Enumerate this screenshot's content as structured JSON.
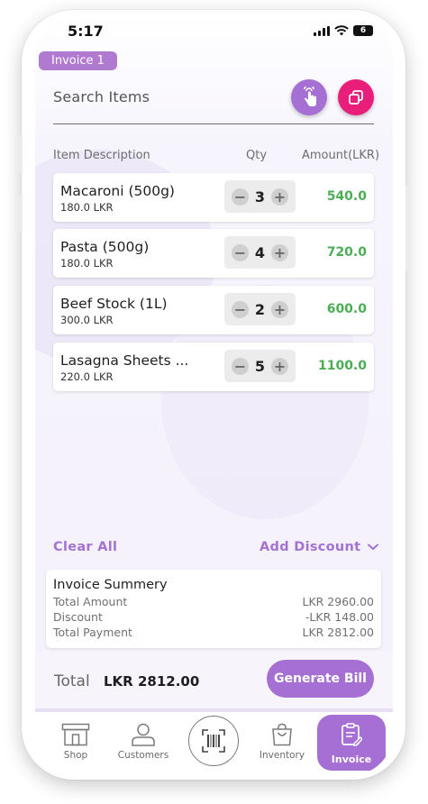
{
  "status_bar": {
    "time": "5:17",
    "battery": "6"
  },
  "invoice_tag": "Invoice 1",
  "search": {
    "placeholder": "Search Items"
  },
  "columns": {
    "description": "Item Description",
    "qty": "Qty",
    "amount": "Amount(LKR)"
  },
  "items": [
    {
      "name": "Macaroni (500g)",
      "unit_price": "180.0 LKR",
      "qty": "3",
      "amount": "540.0"
    },
    {
      "name": "Pasta (500g)",
      "unit_price": "180.0 LKR",
      "qty": "4",
      "amount": "720.0"
    },
    {
      "name": "Beef Stock (1L)",
      "unit_price": "300.0 LKR",
      "qty": "2",
      "amount": "600.0"
    },
    {
      "name": "Lasagna Sheets ...",
      "unit_price": "220.0 LKR",
      "qty": "5",
      "amount": "1100.0"
    }
  ],
  "actions": {
    "clear_all": "Clear All",
    "add_discount": "Add Discount"
  },
  "summary": {
    "title": "Invoice Summery",
    "total_amount_label": "Total Amount",
    "total_amount_value": "LKR 2960.00",
    "discount_label": "Discount",
    "discount_value": "-LKR 148.00",
    "total_payment_label": "Total Payment",
    "total_payment_value": "LKR 2812.00"
  },
  "footer": {
    "total_label": "Total",
    "total_value": "LKR 2812.00",
    "generate_label": "Generate Bill"
  },
  "nav": {
    "shop": "Shop",
    "customers": "Customers",
    "inventory": "Inventory",
    "invoice": "Invoice"
  },
  "icons": {
    "tap": "touch-icon",
    "duplicate": "copy-icon",
    "minus": "minus-icon",
    "plus": "plus-icon",
    "chevron": "chevron-down-icon",
    "shop": "store-icon",
    "customers": "person-icon",
    "scan": "barcode-scan-icon",
    "inventory": "bag-icon",
    "invoice": "invoice-icon"
  },
  "colors": {
    "accent": "#a66fd3",
    "amount_green": "#4cae54",
    "pink": "#e91e7a",
    "tag": "#b07ad1"
  }
}
